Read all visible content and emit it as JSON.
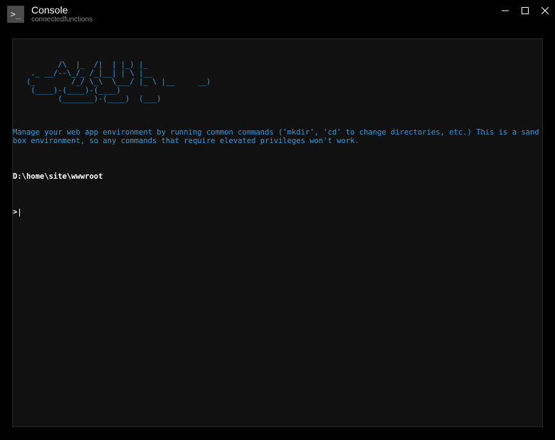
{
  "header": {
    "icon_glyph": ">_",
    "title": "Console",
    "subtitle": "connectedfunctions"
  },
  "terminal": {
    "ascii_art": "          /\\  |_  /|  | |_) |_\n    ._ __/--\\_/_ /_|__| | \\ |__\n   (_        /_/ \\_\\  \\___/ |_ \\ |__     __)\n    (____)-(____)-(____)\n          (_______)-(____)  (___)",
    "help_text": "Manage your web app environment by running common commands ('mkdir', 'cd' to change directories, etc.) This is a sandbox environment, so any commands that require elevated privileges won't work.",
    "cwd": "D:\\home\\site\\wwwroot",
    "prompt": ">",
    "input_value": ""
  },
  "colors": {
    "background": "#000000",
    "panel": "#111111",
    "accent_blue": "#3399dd",
    "text_white": "#ffffff",
    "text_muted": "#8a8a8a"
  }
}
